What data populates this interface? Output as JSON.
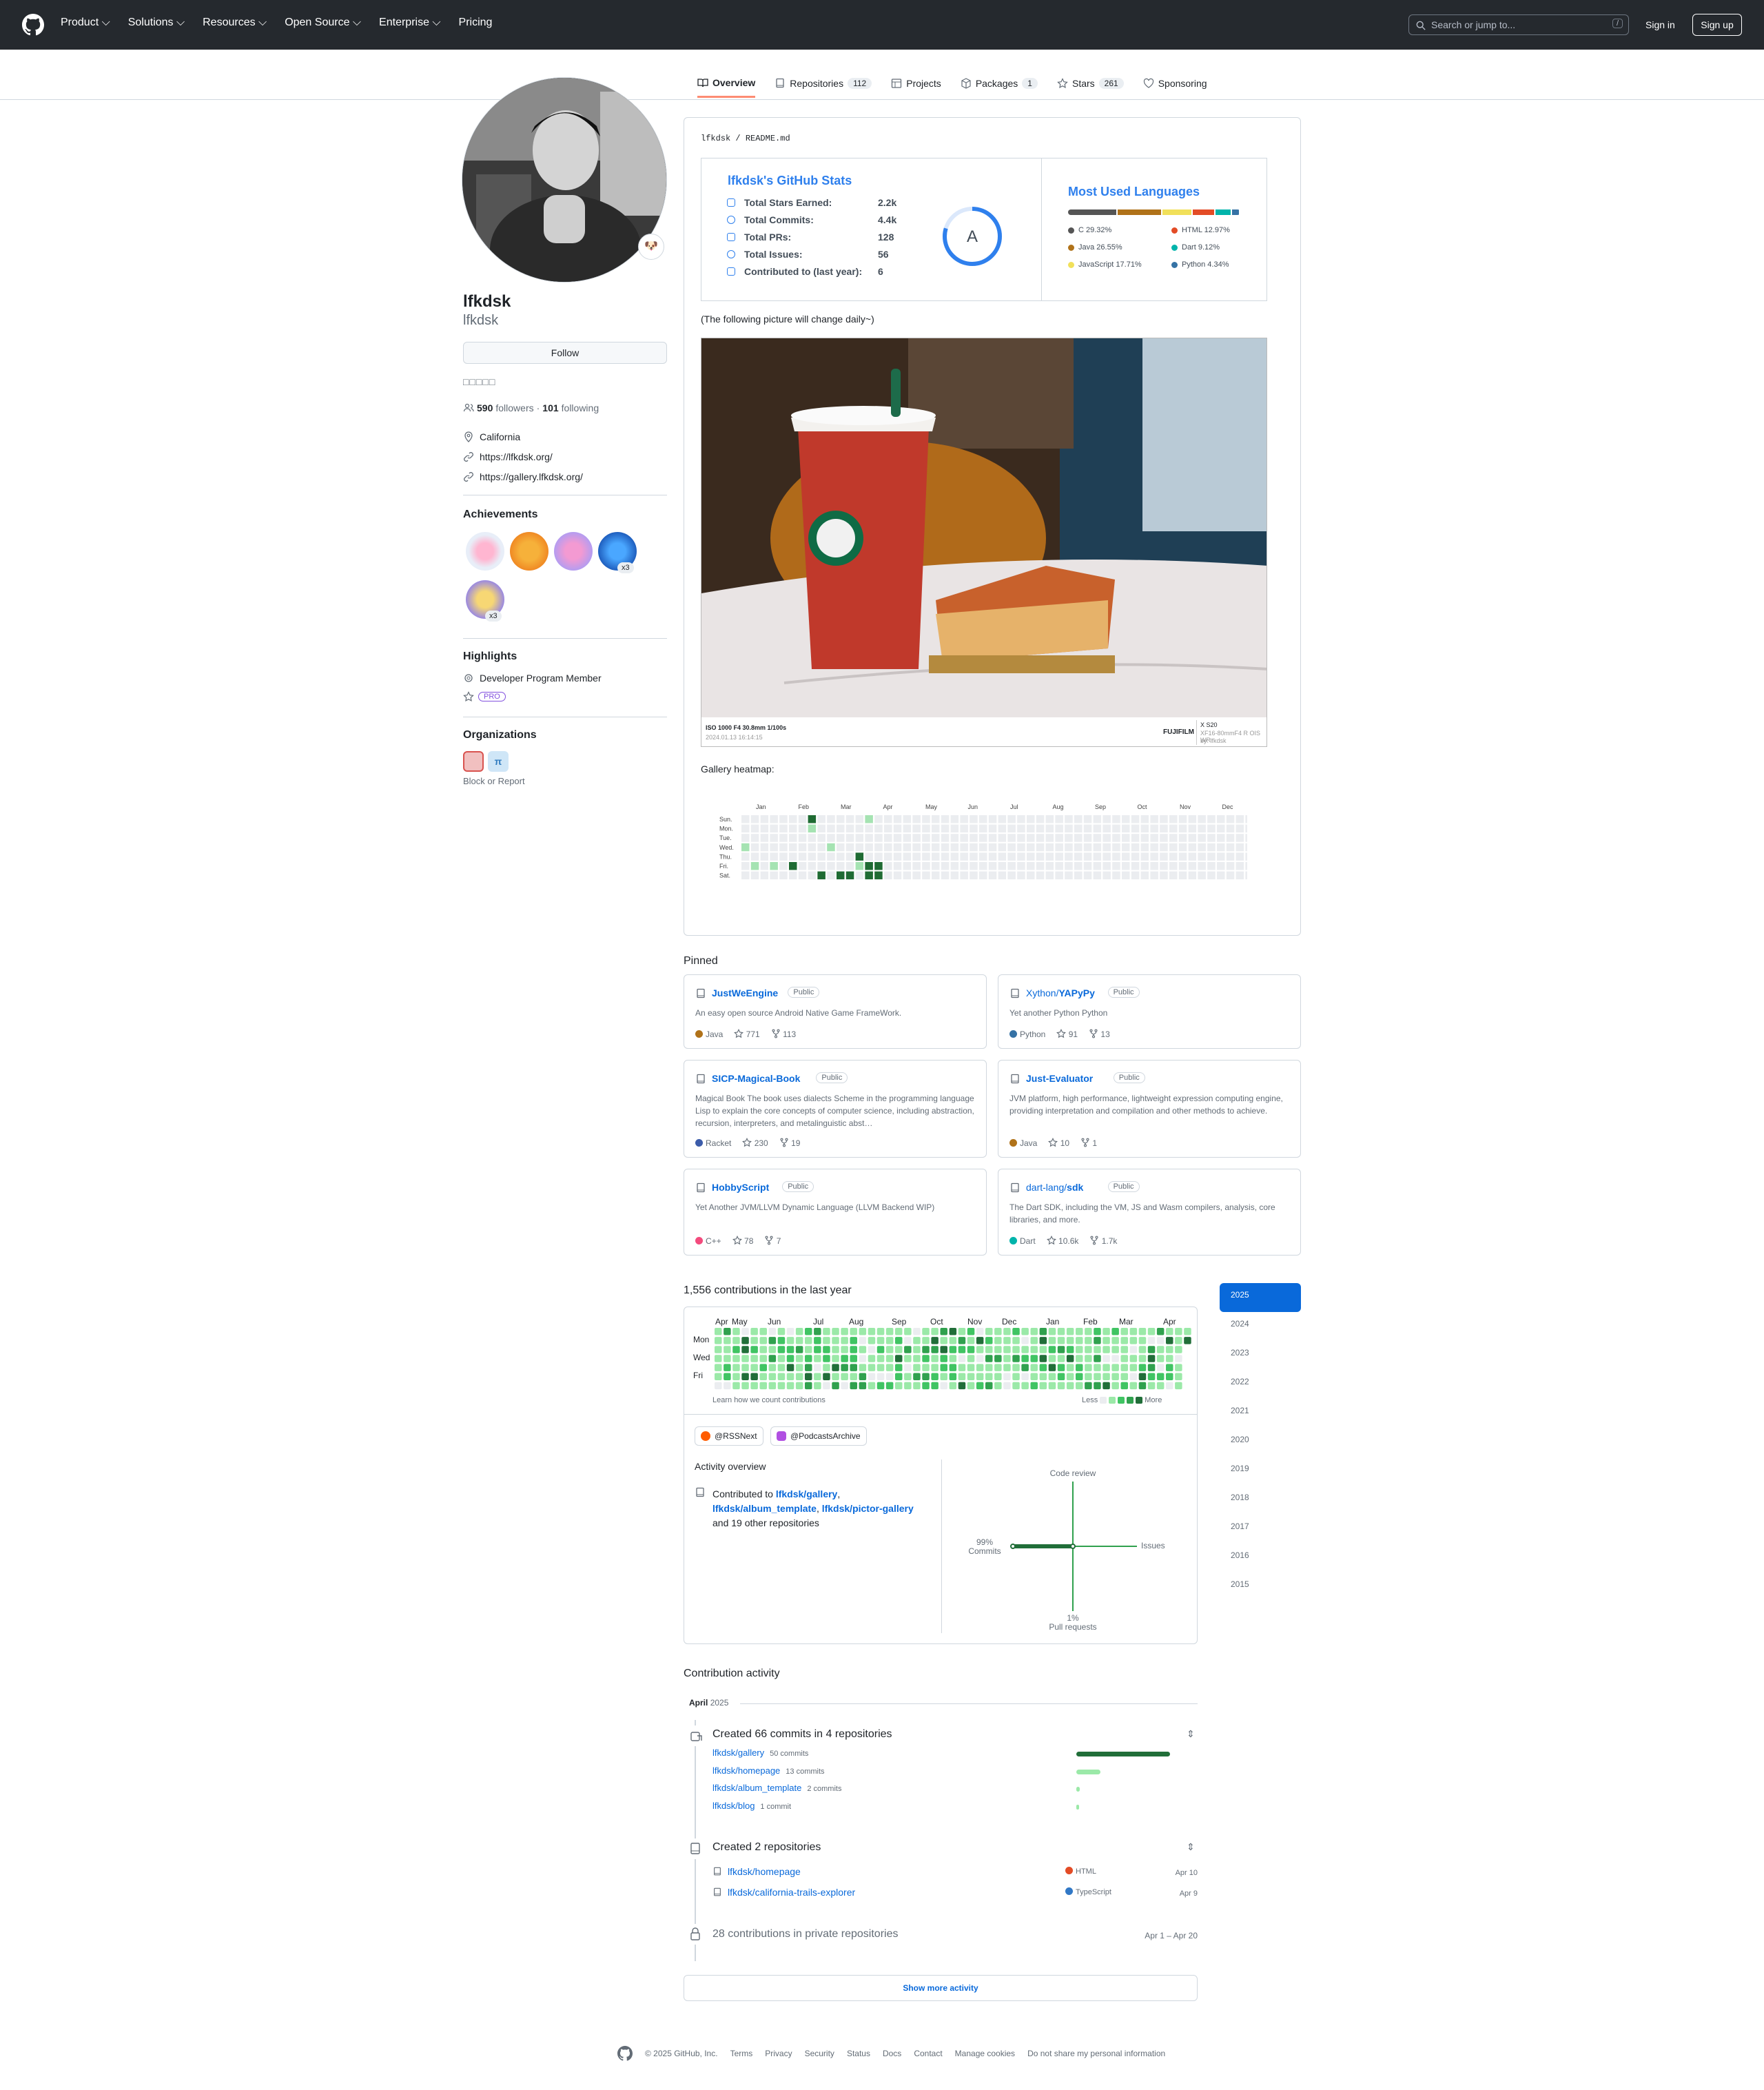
{
  "header": {
    "nav": [
      "Product",
      "Solutions",
      "Resources",
      "Open Source",
      "Enterprise",
      "Pricing"
    ],
    "search_placeholder": "Search or jump to...",
    "search_key": "/",
    "sign_in": "Sign in",
    "sign_up": "Sign up"
  },
  "tabs": [
    {
      "label": "Overview"
    },
    {
      "label": "Repositories",
      "count": "112"
    },
    {
      "label": "Projects"
    },
    {
      "label": "Packages",
      "count": "1"
    },
    {
      "label": "Stars",
      "count": "261"
    },
    {
      "label": "Sponsoring"
    }
  ],
  "profile": {
    "name": "lfkdsk",
    "login": "lfkdsk",
    "follow": "Follow",
    "status_glyphs": "□□□□□",
    "followers": "590",
    "followers_label": "followers",
    "following": "101",
    "following_label": "following",
    "location": "California",
    "link1": "https://lfkdsk.org/",
    "link2": "https://gallery.lfkdsk.org/",
    "avatar_emoji": "�except"
  },
  "achievements": {
    "title": "Achievements",
    "x3a": "x3",
    "x3b": "x3"
  },
  "highlights": {
    "title": "Highlights",
    "item": "Developer Program Member",
    "pro": "PRO"
  },
  "organizations": {
    "title": "Organizations",
    "block": "Block or Report"
  },
  "readme": {
    "path_user": "lfkdsk",
    "path_file": "README.md",
    "note": "(The following picture will change daily~)",
    "gallery": "Gallery heatmap:"
  },
  "stats": {
    "title": "lfkdsk's GitHub Stats",
    "rows": [
      {
        "k": "Total Stars Earned:",
        "v": "2.2k"
      },
      {
        "k": "Total Commits:",
        "v": "4.4k"
      },
      {
        "k": "Total PRs:",
        "v": "128"
      },
      {
        "k": "Total Issues:",
        "v": "56"
      },
      {
        "k": "Contributed to (last year):",
        "v": "6"
      }
    ],
    "grade": "A"
  },
  "languages": {
    "title": "Most Used Languages",
    "items": [
      {
        "n": "C 29.32%",
        "c": "#555555",
        "p": 29.32
      },
      {
        "n": "Java 26.55%",
        "c": "#b07219",
        "p": 26.55
      },
      {
        "n": "JavaScript 17.71%",
        "c": "#f1e05a",
        "p": 17.71
      },
      {
        "n": "HTML 12.97%",
        "c": "#e34c26",
        "p": 12.97
      },
      {
        "n": "Dart 9.12%",
        "c": "#00b4ab",
        "p": 9.12
      },
      {
        "n": "Python 4.34%",
        "c": "#3572a5",
        "p": 4.34
      }
    ]
  },
  "photo": {
    "exif": "ISO 1000 F4 30.8mm 1/100s",
    "date": "2024.01.13 16:14:15",
    "brand": "FUJIFILM",
    "model": "X S20",
    "lens": "XF16-80mmF4 R OIS WR",
    "by": "by: lfkdsk"
  },
  "gallery_heatmap": {
    "months": [
      "Jan",
      "Feb",
      "Mar",
      "Apr",
      "May",
      "Jun",
      "Jul",
      "Aug",
      "Sep",
      "Oct",
      "Nov",
      "Dec"
    ],
    "days": [
      "Sun.",
      "Mon.",
      "Tue.",
      "Wed.",
      "Thu.",
      "Fri.",
      "Sat."
    ]
  },
  "pinned": {
    "title": "Pinned",
    "public": "Public",
    "items": [
      {
        "owner": "",
        "name": "JustWeEngine",
        "desc": "An easy open source Android Native Game FrameWork.",
        "lang": "Java",
        "color": "#b07219",
        "stars": "771",
        "forks": "113"
      },
      {
        "owner": "Xython/",
        "name": "YAPyPy",
        "desc": "Yet another Python Python",
        "lang": "Python",
        "color": "#3572a5",
        "stars": "91",
        "forks": "13"
      },
      {
        "owner": "",
        "name": "SICP-Magical-Book",
        "desc": "Magical Book The book uses dialects Scheme in the programming language Lisp to explain the core concepts of computer science, including abstraction, recursion, interpreters, and metalinguistic abst…",
        "lang": "Racket",
        "color": "#3c5caa",
        "stars": "230",
        "forks": "19"
      },
      {
        "owner": "",
        "name": "Just-Evaluator",
        "desc": "JVM platform, high performance, lightweight expression computing engine, providing interpretation and compilation and other methods to achieve.",
        "lang": "Java",
        "color": "#b07219",
        "stars": "10",
        "forks": "1"
      },
      {
        "owner": "",
        "name": "HobbyScript",
        "desc": "Yet Another JVM/LLVM Dynamic Language (LLVM Backend WIP)",
        "lang": "C++",
        "color": "#f34b7d",
        "stars": "78",
        "forks": "7"
      },
      {
        "owner": "dart-lang/",
        "name": "sdk",
        "desc": "The Dart SDK, including the VM, JS and Wasm compilers, analysis, core libraries, and more.",
        "lang": "Dart",
        "color": "#00b4ab",
        "stars": "10.6k",
        "forks": "1.7k"
      }
    ]
  },
  "contributions": {
    "title": "1,556 contributions in the last year",
    "months": [
      "Apr",
      "May",
      "Jun",
      "Jul",
      "Aug",
      "Sep",
      "Oct",
      "Nov",
      "Dec",
      "Jan",
      "Feb",
      "Mar",
      "Apr"
    ],
    "days": [
      "Mon",
      "Wed",
      "Fri"
    ],
    "learn": "Learn how we count contributions",
    "less": "Less",
    "more": "More",
    "orgs": [
      "@RSSNext",
      "@PodcastsArchive"
    ]
  },
  "years": [
    "2025",
    "2024",
    "2023",
    "2022",
    "2021",
    "2020",
    "2019",
    "2018",
    "2017",
    "2016",
    "2015"
  ],
  "overview": {
    "title": "Activity overview",
    "contributed_to": "Contributed to",
    "r1": "lfkdsk/gallery",
    "r2": "lfkdsk/album_template",
    "r3": "lfkdsk/pictor-gallery",
    "others": "and 19 other repositories",
    "code_review": "Code review",
    "issues": "Issues",
    "pct_commits": "99%",
    "commits": "Commits",
    "pct_pr": "1%",
    "pull_requests": "Pull requests"
  },
  "activity": {
    "title": "Contribution activity",
    "month": "April",
    "year": "2025",
    "commits_title": "Created 66 commits in 4 repositories",
    "commit_repos": [
      {
        "name": "lfkdsk/gallery",
        "count": "50 commits",
        "frac": 1.0
      },
      {
        "name": "lfkdsk/homepage",
        "count": "13 commits",
        "frac": 0.26
      },
      {
        "name": "lfkdsk/album_template",
        "count": "2 commits",
        "frac": 0.04
      },
      {
        "name": "lfkdsk/blog",
        "count": "1 commit",
        "frac": 0.02
      }
    ],
    "repos_title": "Created 2 repositories",
    "new_repos": [
      {
        "name": "lfkdsk/homepage",
        "lang": "HTML",
        "color": "#e34c26",
        "date": "Apr 10"
      },
      {
        "name": "lfkdsk/california-trails-explorer",
        "lang": "TypeScript",
        "color": "#3178c6",
        "date": "Apr 9"
      }
    ],
    "private": "28 contributions in private repositories",
    "private_range": "Apr 1 – Apr 20",
    "show_more": "Show more activity"
  },
  "footer": {
    "copyright": "© 2025 GitHub, Inc.",
    "links": [
      "Terms",
      "Privacy",
      "Security",
      "Status",
      "Docs",
      "Contact",
      "Manage cookies",
      "Do not share my personal information"
    ]
  }
}
